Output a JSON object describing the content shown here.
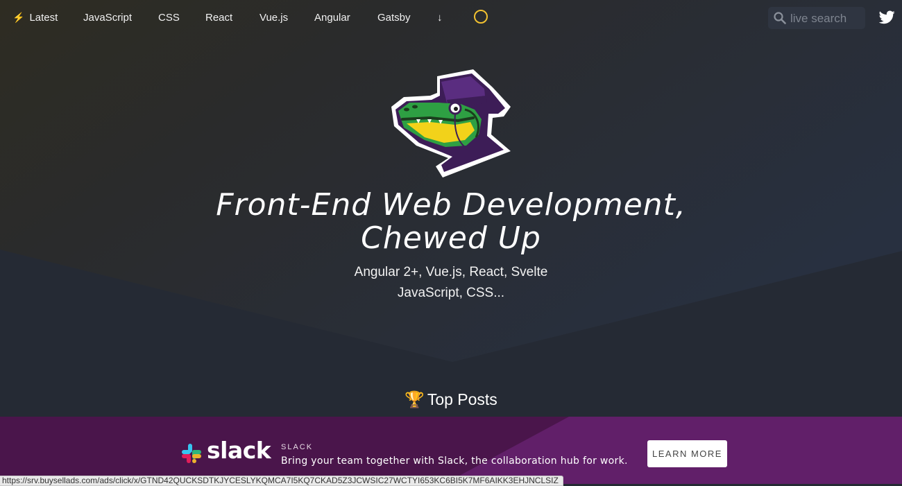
{
  "nav": {
    "items": [
      {
        "label": "Latest",
        "icon": "lightning-icon"
      },
      {
        "label": "JavaScript"
      },
      {
        "label": "CSS"
      },
      {
        "label": "React"
      },
      {
        "label": "Vue.js"
      },
      {
        "label": "Angular"
      },
      {
        "label": "Gatsby"
      },
      {
        "label": "↓"
      }
    ],
    "search_placeholder": "live search",
    "theme_toggle_icon": "circle-icon",
    "social_icon": "twitter-icon"
  },
  "hero": {
    "title_line1": "Front-End Web Development,",
    "title_line2": "Chewed Up",
    "subtitle_line1": "Angular 2+, Vue.js, React, Svelte",
    "subtitle_line2": "JavaScript, CSS..."
  },
  "top_posts": {
    "icon": "🏆",
    "label": "Top Posts"
  },
  "ad": {
    "brand": "slack",
    "company": "SLACK",
    "text": "Bring your team together with Slack, the collaboration hub for work.",
    "button": "LEARN MORE"
  },
  "status_url": "https://srv.buysellads.com/ads/click/x/GTND42QUCKSDTKJYCESLYKQMCA7I5KQ7CKAD5Z3JCWSIC27WCTYI653KC6BI5K7MF6AIKK3EHJNCLSIZ",
  "colors": {
    "background": "#252a34",
    "accent_yellow": "#f2c230",
    "ad_purple": "#4a154b"
  }
}
